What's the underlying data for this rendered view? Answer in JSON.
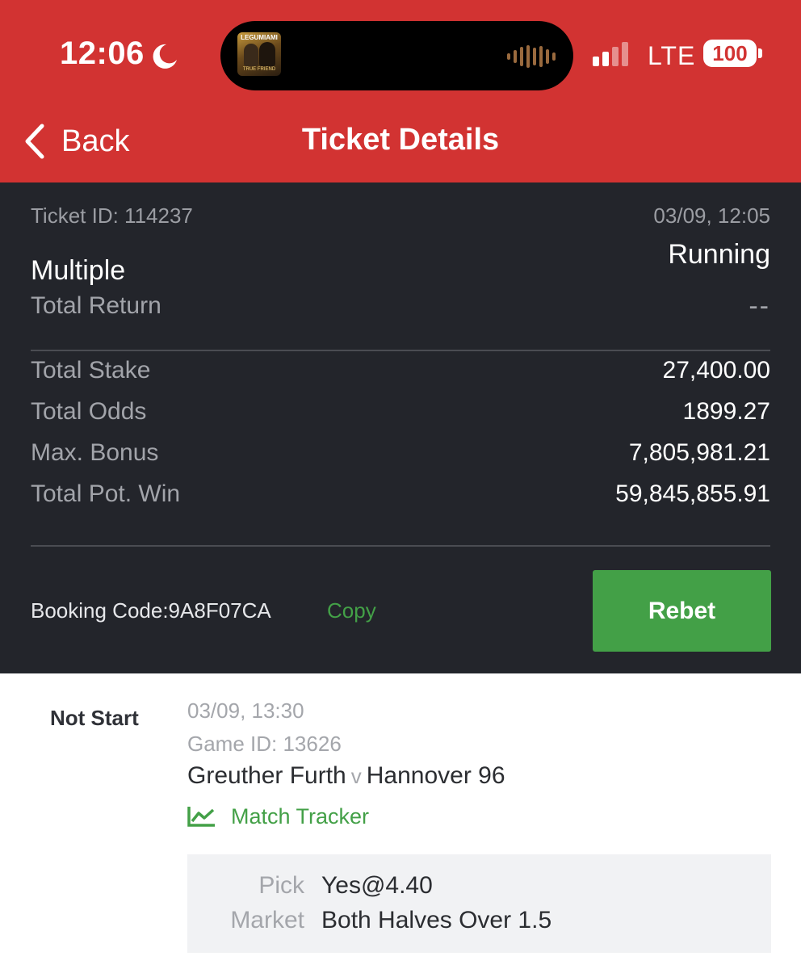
{
  "status_bar": {
    "time": "12:06",
    "network": "LTE",
    "battery": "100",
    "now_playing": {
      "artist_text": "LEGUMIAMI",
      "album_text": "TRUE FRIEND"
    }
  },
  "header": {
    "back_label": "Back",
    "title": "Ticket Details"
  },
  "ticket": {
    "id": "Ticket ID: 114237",
    "date": "03/09, 12:05",
    "type": "Multiple",
    "status": "Running",
    "total_return_label": "Total Return",
    "total_return_value": "--",
    "rows": [
      {
        "label": "Total Stake",
        "value": "27,400.00"
      },
      {
        "label": "Total Odds",
        "value": "1899.27"
      },
      {
        "label": "Max. Bonus",
        "value": "7,805,981.21"
      },
      {
        "label": "Total Pot. Win",
        "value": "59,845,855.91"
      }
    ],
    "booking_code": "Booking Code:9A8F07CA",
    "copy_label": "Copy",
    "rebet_label": "Rebet"
  },
  "selections": [
    {
      "status": "Not Start",
      "time": "03/09, 13:30",
      "game_id": "Game ID: 13626",
      "home": "Greuther Furth",
      "separator": "v",
      "away": "Hannover 96",
      "tracker_label": "Match Tracker",
      "pick_label": "Pick",
      "pick_value": "Yes@4.40",
      "market_label": "Market",
      "market_value": "Both Halves Over 1.5"
    }
  ],
  "colors": {
    "header_red": "#d23332",
    "panel_dark": "#23252b",
    "accent_green": "#43a047"
  }
}
